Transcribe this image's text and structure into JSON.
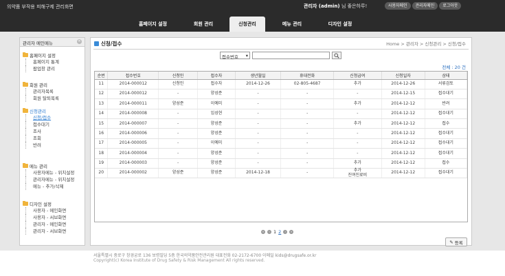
{
  "header": {
    "site_title": "의약품 부작용 피해구제 관리화면",
    "welcome_user": "관리자 (admin)",
    "welcome_rest": "님 좋은하루!",
    "links": [
      "사용자메인",
      "관리자메인",
      "로그아웃"
    ]
  },
  "nav": {
    "tabs": [
      "홈페이지 설정",
      "회원 관리",
      "신청관리",
      "메뉴 관리",
      "디자인 설정"
    ],
    "active": "신청관리"
  },
  "sidebar": {
    "title": "관리자 메인메뉴",
    "groups": [
      {
        "title": "홈페이지 설정",
        "items": [
          "홈페이지 통계",
          "팝업창 관리"
        ]
      },
      {
        "title": "회원 관리",
        "items": [
          "관리자목록",
          "회원 탈퇴목록"
        ]
      },
      {
        "title": "신청관리",
        "items": [
          "신청/접수",
          "접수대기",
          "조사",
          "조회",
          "반려"
        ]
      },
      {
        "title": "메뉴 관리",
        "items": [
          "사용자메뉴 - 위치설정",
          "관리자메뉴 - 위치설정",
          "메뉴 - 추가/삭제"
        ]
      },
      {
        "title": "디자인 설정",
        "items": [
          "사용자 - 메인화면",
          "사용자 - 서브화면",
          "관리자 - 메인화면",
          "관리자 - 서브화면"
        ]
      }
    ]
  },
  "content": {
    "title": "신청/접수",
    "breadcrumb": "Home > 관리자 > 신청관리 > 신청/접수",
    "search": {
      "select_value": "접수번호",
      "placeholder": ""
    },
    "total": "전체 : 20 건",
    "table": {
      "headers": [
        "순번",
        "접수번호",
        "신청인",
        "접수자",
        "생년월일",
        "휴대전화",
        "신청급여",
        "신청일자",
        "상태"
      ],
      "rows": [
        [
          "11",
          "2014-000012",
          "신청인",
          "접수자",
          "2014-12-26",
          "02-805-4687",
          "추가",
          "2014-12-26",
          "서류검토"
        ],
        [
          "12",
          "2014-000012",
          "-",
          "양성준",
          "-",
          "-",
          "-",
          "2014-12-15",
          "접수대기"
        ],
        [
          "13",
          "2014-000011",
          "양성준",
          "이예미",
          "-",
          "-",
          "추가",
          "2014-12-12",
          "반려"
        ],
        [
          "14",
          "2014-000008",
          "-",
          "임성현",
          "-",
          "-",
          "-",
          "2014-12-12",
          "접수대기"
        ],
        [
          "15",
          "2014-000007",
          "-",
          "양성준",
          "-",
          "-",
          "추가",
          "2014-12-12",
          "접수"
        ],
        [
          "16",
          "2014-000006",
          "-",
          "양성준",
          "-",
          "-",
          "-",
          "2014-12-12",
          "접수대기"
        ],
        [
          "17",
          "2014-000005",
          "-",
          "이예미",
          "-",
          "-",
          "-",
          "2014-12-12",
          "접수대기"
        ],
        [
          "18",
          "2014-000004",
          "-",
          "양성준",
          "-",
          "-",
          "-",
          "2014-12-12",
          "접수대기"
        ],
        [
          "19",
          "2014-000003",
          "-",
          "양성준",
          "-",
          "-",
          "추가",
          "2014-12-12",
          "접수"
        ],
        [
          "20",
          "2014-000002",
          "양성준",
          "양성준",
          "2014-12-18",
          "-",
          "추가\n진여진료비",
          "2014-12-12",
          "접수대기"
        ]
      ]
    },
    "pager": {
      "pages": [
        "1",
        "2"
      ],
      "current": "2"
    },
    "register_label": "등록"
  },
  "footer": {
    "line1": "서울특별시 중로구 창경궁로 136 보령빌딩 5층 한국의약품안전관리원 대표전화 02-2172-6700 이메일 kids@drugsafe.or.kr",
    "line2": "Copyright(c) Korea Institute of Drug Safety & Risk Management All rights reserved."
  }
}
